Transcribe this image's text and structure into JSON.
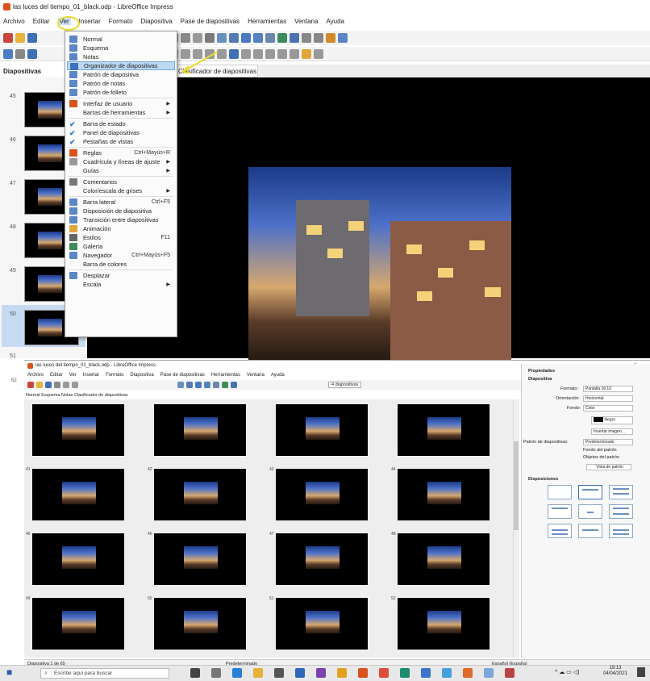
{
  "top_window": {
    "title": "las luces del tiempo_01_black.odp - LibreOffice Impress",
    "menu": [
      "Archivo",
      "Editar",
      "Ver",
      "Insertar",
      "Formato",
      "Diapositiva",
      "Pase de diapositivas",
      "Herramientas",
      "Ventana",
      "Ayuda"
    ],
    "sidebar_title": "Diapositivas",
    "active_tab": "Clasificador de diapositivas",
    "thumb_numbers": [
      "45",
      "46",
      "47",
      "48",
      "49",
      "50",
      "51",
      "52"
    ],
    "selected_thumb": "50"
  },
  "view_menu": {
    "items": [
      {
        "label": "Normal",
        "icon": "normal-view-icon",
        "type": "icon"
      },
      {
        "label": "Esquema",
        "icon": "outline-view-icon",
        "type": "icon"
      },
      {
        "label": "Notas",
        "icon": "notes-view-icon",
        "type": "icon"
      },
      {
        "label": "Organizador de diapositivas",
        "icon": "slide-sorter-icon",
        "type": "icon",
        "highlight": true
      },
      {
        "label": "Patrón de diapositiva",
        "icon": "master-slide-icon",
        "type": "icon"
      },
      {
        "label": "Patrón de notas",
        "icon": "master-notes-icon",
        "type": "icon"
      },
      {
        "label": "Patrón de folleto",
        "icon": "master-handout-icon",
        "type": "icon"
      },
      {
        "sep": true
      },
      {
        "label": "Interfaz de usuario",
        "icon": "ui-icon",
        "type": "icon",
        "submenu": true
      },
      {
        "label": "Barras de herramientas",
        "type": "none",
        "submenu": true
      },
      {
        "sep": true
      },
      {
        "label": "Barra de estado",
        "type": "check"
      },
      {
        "label": "Panel de diapositivas",
        "type": "check"
      },
      {
        "label": "Pestañas de vistas",
        "type": "check"
      },
      {
        "sep": true
      },
      {
        "label": "Reglas",
        "icon": "rulers-icon",
        "type": "icon",
        "shortcut": "Ctrl+Mayús+R"
      },
      {
        "label": "Cuadrícula y líneas de ajuste",
        "icon": "grid-icon",
        "type": "icon",
        "submenu": true
      },
      {
        "label": "Guías",
        "type": "none",
        "submenu": true
      },
      {
        "sep": true
      },
      {
        "label": "Comentarios",
        "icon": "comments-icon",
        "type": "icon"
      },
      {
        "label": "Color/escala de grises",
        "type": "none",
        "submenu": true
      },
      {
        "sep": true
      },
      {
        "label": "Barra lateral",
        "icon": "sidebar-icon",
        "type": "icon",
        "shortcut": "Ctrl+F5"
      },
      {
        "label": "Disposición de diapositiva",
        "icon": "layout-icon",
        "type": "icon"
      },
      {
        "label": "Transición entre diapositivas",
        "icon": "transition-icon",
        "type": "icon"
      },
      {
        "label": "Animación",
        "icon": "animation-icon",
        "type": "icon"
      },
      {
        "label": "Estilos",
        "icon": "styles-icon",
        "type": "icon",
        "shortcut": "F11"
      },
      {
        "label": "Galería",
        "icon": "gallery-icon",
        "type": "icon"
      },
      {
        "label": "Navegador",
        "icon": "navigator-icon",
        "type": "icon",
        "shortcut": "Ctrl+Mayús+F5"
      },
      {
        "label": "Barra de colores",
        "type": "none"
      },
      {
        "sep": true
      },
      {
        "label": "Desplazar",
        "icon": "pan-icon",
        "type": "icon"
      },
      {
        "label": "Escala",
        "type": "none",
        "submenu": true
      }
    ]
  },
  "bottom_window": {
    "title": "las luces del tiempo_01_black.odp - LibreOffice Impress",
    "menu": [
      "Archivo",
      "Editar",
      "Ver",
      "Insertar",
      "Formato",
      "Diapositiva",
      "Pase de diapositivas",
      "Herramientas",
      "Ventana",
      "Ayuda"
    ],
    "slides_combo": "4 diapositivas",
    "tabs": "Normal  Esquema  Notas  Clasificador de diapositivas",
    "slide_numbers": [
      "",
      "",
      "",
      "",
      "41",
      "42",
      "43",
      "44",
      "45",
      "46",
      "47",
      "48",
      "49",
      "50",
      "51",
      "52"
    ],
    "left_thumb_number": "52",
    "props_title": "Propiedades",
    "section_slide": "Diapositiva",
    "format_label": "Formato:",
    "format_value": "Pantalla 16:10",
    "orient_label": "Orientación:",
    "orient_value": "Horizontal",
    "fill_label": "Fondo:",
    "fill_value": "Color",
    "color_value": "Negro",
    "insert_image_btn": "Insertar imagen...",
    "master_label": "Patrón de diapositivas:",
    "master_value": "Predeterminado",
    "master_bg_check": "Fondo del patrón",
    "master_obj_check": "Objetos del patrón",
    "master_view_btn": "Vista de patrón",
    "section_layouts": "Disposiciones",
    "status_left": "Diapositiva 1 de 65",
    "status_mid": "Predeterminado",
    "status_lang": "Español (España)"
  },
  "taskbar": {
    "search_placeholder": "Escribe aquí para buscar",
    "time": "19:13",
    "date": "04/04/2021"
  }
}
